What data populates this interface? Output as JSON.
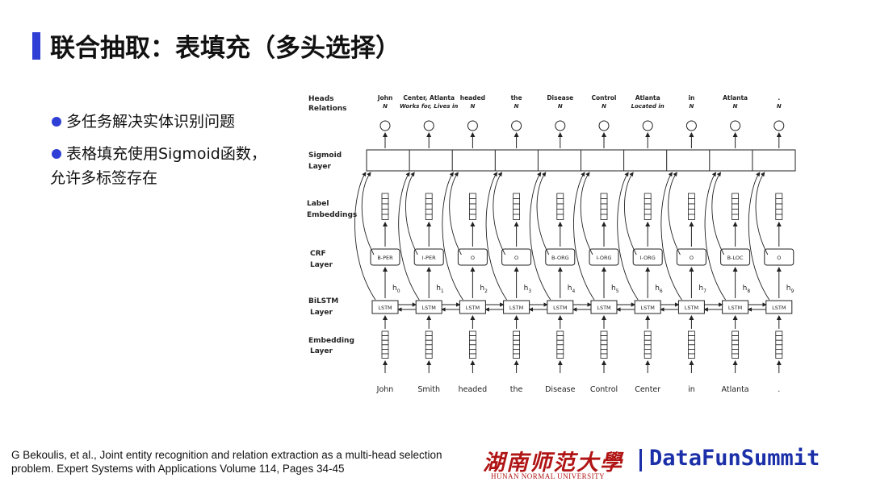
{
  "slide": {
    "title": "联合抽取：表填充（多头选择）",
    "bullets": [
      {
        "line1": "多任务解决实体识别问题",
        "line2": ""
      },
      {
        "line1": "表格填充使用Sigmoid函数，",
        "line2": "允许多标签存在"
      }
    ],
    "citation_line1": "G Bekoulis, et al., Joint entity recognition and relation extraction as a multi-head selection",
    "citation_line2": "problem. Expert Systems with Applications Volume 114, Pages 34-45",
    "logo_cn": "湖南师范大學",
    "logo_en": "HUNAN NORMAL UNIVERSITY",
    "logo_brand": "DataFunSummit",
    "accent_color": "#2f3fd6"
  },
  "diagram": {
    "layer_labels": {
      "heads": "Heads",
      "relations": "Relations",
      "sigmoid1": "Sigmoid",
      "sigmoid2": "Layer",
      "label1": "Label",
      "label2": "Embeddings",
      "crf1": "CRF",
      "crf2": "Layer",
      "bilstm1": "BiLSTM",
      "bilstm2": "Layer",
      "emb1": "Embedding",
      "emb2": "Layer"
    },
    "lstm_label": "LSTM",
    "hidden_prefix": "h",
    "columns": [
      {
        "word": "John",
        "crf": "B-PER",
        "head": "John",
        "rel": "N",
        "h": "0"
      },
      {
        "word": "Smith",
        "crf": "I-PER",
        "head": "Center, Atlanta",
        "rel": "Works for, Lives in",
        "h": "1"
      },
      {
        "word": "headed",
        "crf": "O",
        "head": "headed",
        "rel": "N",
        "h": "2"
      },
      {
        "word": "the",
        "crf": "O",
        "head": "the",
        "rel": "N",
        "h": "3"
      },
      {
        "word": "Disease",
        "crf": "B-ORG",
        "head": "Disease",
        "rel": "N",
        "h": "4"
      },
      {
        "word": "Control",
        "crf": "I-ORG",
        "head": "Control",
        "rel": "N",
        "h": "5"
      },
      {
        "word": "Center",
        "crf": "I-ORG",
        "head": "Atlanta",
        "rel": "Located in",
        "h": "6"
      },
      {
        "word": "in",
        "crf": "O",
        "head": "in",
        "rel": "N",
        "h": "7"
      },
      {
        "word": "Atlanta",
        "crf": "B-LOC",
        "head": "Atlanta",
        "rel": "N",
        "h": "8"
      },
      {
        "word": ".",
        "crf": "O",
        "head": ".",
        "rel": "N",
        "h": "9"
      }
    ]
  }
}
